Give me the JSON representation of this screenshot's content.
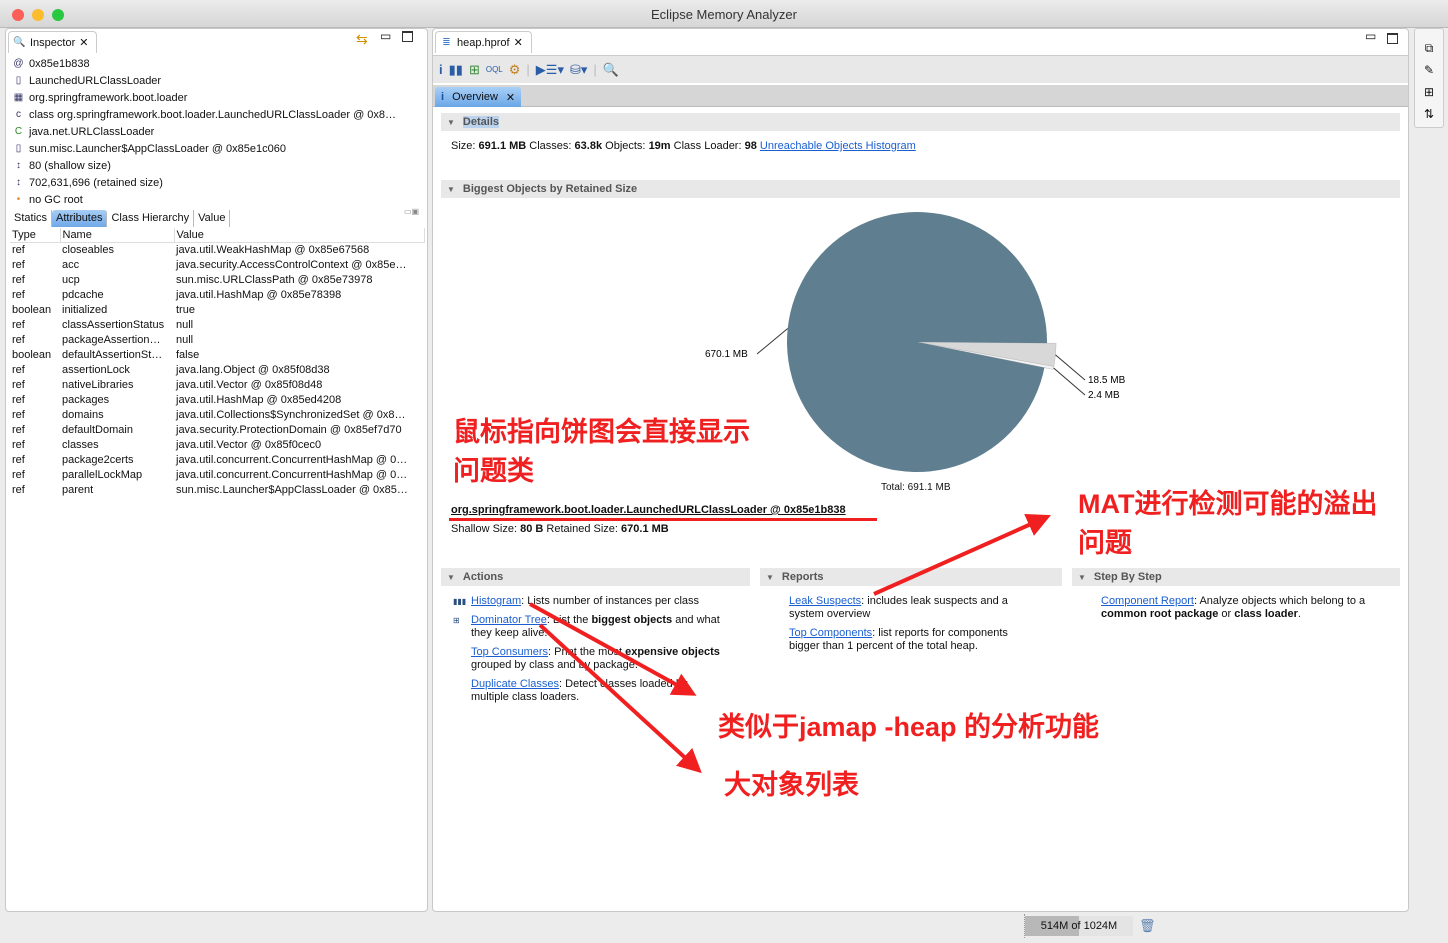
{
  "window": {
    "title": "Eclipse Memory Analyzer"
  },
  "inspector": {
    "tab_label": "Inspector",
    "rows": [
      {
        "icon": "@",
        "text": "0x85e1b838"
      },
      {
        "icon": "▯",
        "text": "LaunchedURLClassLoader"
      },
      {
        "icon": "▦",
        "text": "org.springframework.boot.loader"
      },
      {
        "icon": "c",
        "text": "class org.springframework.boot.loader.LaunchedURLClassLoader @ 0x8…"
      },
      {
        "icon": "C",
        "text": "java.net.URLClassLoader"
      },
      {
        "icon": "▯",
        "text": "sun.misc.Launcher$AppClassLoader @ 0x85e1c060"
      },
      {
        "icon": "↕",
        "text": "80 (shallow size)"
      },
      {
        "icon": "↕",
        "text": "702,631,696 (retained size)"
      },
      {
        "icon": "•",
        "text": "no GC root"
      }
    ],
    "subtabs": [
      "Statics",
      "Attributes",
      "Class Hierarchy",
      "Value"
    ],
    "active_subtab": "Attributes",
    "columns": [
      "Type",
      "Name",
      "Value"
    ],
    "attributes": [
      [
        "ref",
        "closeables",
        "java.util.WeakHashMap @ 0x85e67568"
      ],
      [
        "ref",
        "acc",
        "java.security.AccessControlContext @ 0x85e…"
      ],
      [
        "ref",
        "ucp",
        "sun.misc.URLClassPath @ 0x85e73978"
      ],
      [
        "ref",
        "pdcache",
        "java.util.HashMap @ 0x85e78398"
      ],
      [
        "boolean",
        "initialized",
        "true"
      ],
      [
        "ref",
        "classAssertionStatus",
        "null"
      ],
      [
        "ref",
        "packageAssertion…",
        "null"
      ],
      [
        "boolean",
        "defaultAssertionSt…",
        "false"
      ],
      [
        "ref",
        "assertionLock",
        "java.lang.Object @ 0x85f08d38"
      ],
      [
        "ref",
        "nativeLibraries",
        "java.util.Vector @ 0x85f08d48"
      ],
      [
        "ref",
        "packages",
        "java.util.HashMap @ 0x85ed4208"
      ],
      [
        "ref",
        "domains",
        "java.util.Collections$SynchronizedSet @ 0x8…"
      ],
      [
        "ref",
        "defaultDomain",
        "java.security.ProtectionDomain @ 0x85ef7d70"
      ],
      [
        "ref",
        "classes",
        "java.util.Vector @ 0x85f0cec0"
      ],
      [
        "ref",
        "package2certs",
        "java.util.concurrent.ConcurrentHashMap @ 0…"
      ],
      [
        "ref",
        "parallelLockMap",
        "java.util.concurrent.ConcurrentHashMap @ 0…"
      ],
      [
        "ref",
        "parent",
        "sun.misc.Launcher$AppClassLoader @ 0x85…"
      ]
    ]
  },
  "editor": {
    "tab_label": "heap.hprof",
    "overview_tab": "Overview",
    "details": {
      "title": "Details",
      "size_label": "Size:",
      "size": "691.1 MB",
      "classes_label": "Classes:",
      "classes": "63.8k",
      "objects_label": "Objects:",
      "objects": "19m",
      "loader_label": "Class Loader:",
      "loader": "98",
      "link": "Unreachable Objects Histogram"
    },
    "biggest": {
      "title": "Biggest Objects by Retained Size",
      "total": "Total: 691.1 MB",
      "object": "org.springframework.boot.loader.LaunchedURLClassLoader @ 0x85e1b838",
      "shallow_label": "Shallow Size:",
      "shallow": "80 B",
      "retained_label": "Retained Size:",
      "retained": "670.1 MB"
    },
    "actions": {
      "title": "Actions",
      "items": [
        {
          "link": "Histogram",
          "text": ": Lists number of instances per class"
        },
        {
          "link": "Dominator Tree",
          "text": ": List the ",
          "bold": "biggest objects",
          "text2": " and what they keep alive."
        },
        {
          "link": "Top Consumers",
          "text": ": Print the most ",
          "bold": "expensive objects",
          "text2": " grouped by class and by package."
        },
        {
          "link": "Duplicate Classes",
          "text": ": Detect classes loaded by multiple class loaders."
        }
      ]
    },
    "reports": {
      "title": "Reports",
      "items": [
        {
          "link": "Leak Suspects",
          "text": ": includes leak suspects and a system overview"
        },
        {
          "link": "Top Components",
          "text": ": list reports for components bigger than 1 percent of the total heap."
        }
      ]
    },
    "stepbystep": {
      "title": "Step By Step",
      "link": "Component Report",
      "text": ": Analyze objects which belong to a ",
      "bold1": "common root package",
      "or": " or ",
      "bold2": "class loader",
      "end": "."
    }
  },
  "chart_data": {
    "type": "pie",
    "title": "Biggest Objects by Retained Size",
    "total": "Total: 691.1 MB",
    "slices": [
      {
        "label": "670.1 MB",
        "value": 670.1,
        "color": "#5f7e8f"
      },
      {
        "label": "18.5 MB",
        "value": 18.5,
        "color": "#d8d8d8"
      },
      {
        "label": "2.4 MB",
        "value": 2.4,
        "color": "#f2f2f2"
      }
    ]
  },
  "annotations": {
    "a1": "鼠标指向饼图会直接显示",
    "a2": "问题类",
    "a3": "MAT进行检测可能的溢出",
    "a4": "问题",
    "a5": "类似于jamap -heap 的分析功能",
    "a6": "大对象列表"
  },
  "status": {
    "memory": "514M of 1024M",
    "memory_fraction": 0.5
  }
}
